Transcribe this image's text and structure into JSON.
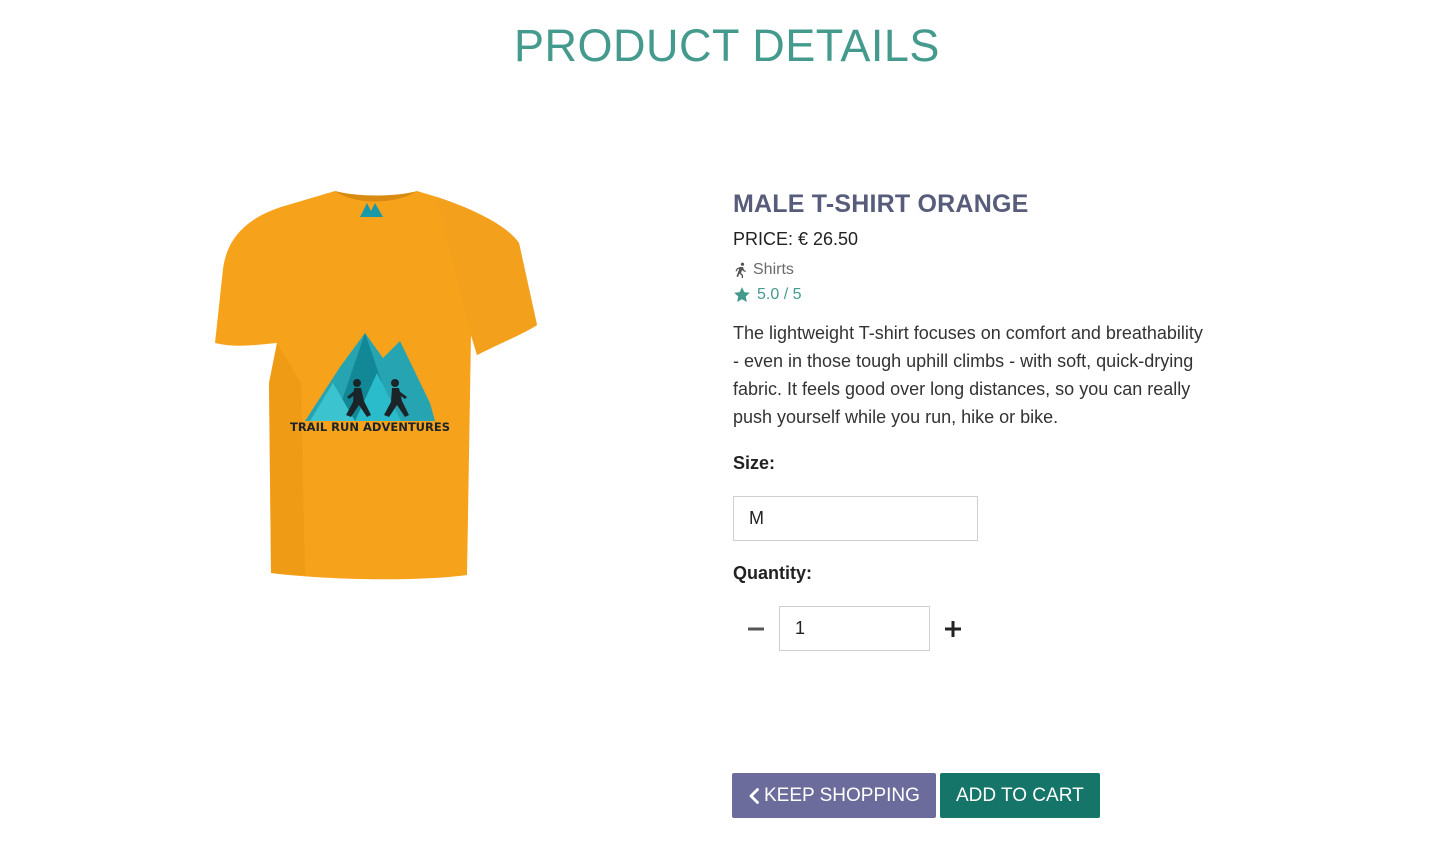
{
  "page": {
    "title": "PRODUCT DETAILS"
  },
  "colors": {
    "title": "#449a8d",
    "product_name": "#575c7b",
    "rating": "#449a8d",
    "keep_shopping_button": "#6b6c9c",
    "add_to_cart_button": "#147568",
    "shirt": "#f7a21b"
  },
  "product": {
    "image_icon": "orange-tshirt-image",
    "logo_text": "TRAIL RUN ADVENTURES",
    "name": "MALE T-SHIRT ORANGE",
    "price": "PRICE: € 26.50",
    "category_icon": "running-person-icon",
    "category": "Shirts",
    "rating_icon": "star-icon",
    "rating": "5.0 / 5",
    "description": "The lightweight T-shirt focuses on comfort and breathability - even in those tough uphill climbs - with soft, quick-drying fabric. It feels good over long distances, so you can really push yourself while you run, hike or bike."
  },
  "form": {
    "size_label": "Size:",
    "size_value": "M",
    "quantity_label": "Quantity:",
    "quantity_value": "1",
    "decrement_icon": "minus-icon",
    "increment_icon": "plus-icon"
  },
  "actions": {
    "keep_shopping_icon": "chevron-left-icon",
    "keep_shopping": "KEEP SHOPPING",
    "add_to_cart": "ADD TO CART"
  }
}
